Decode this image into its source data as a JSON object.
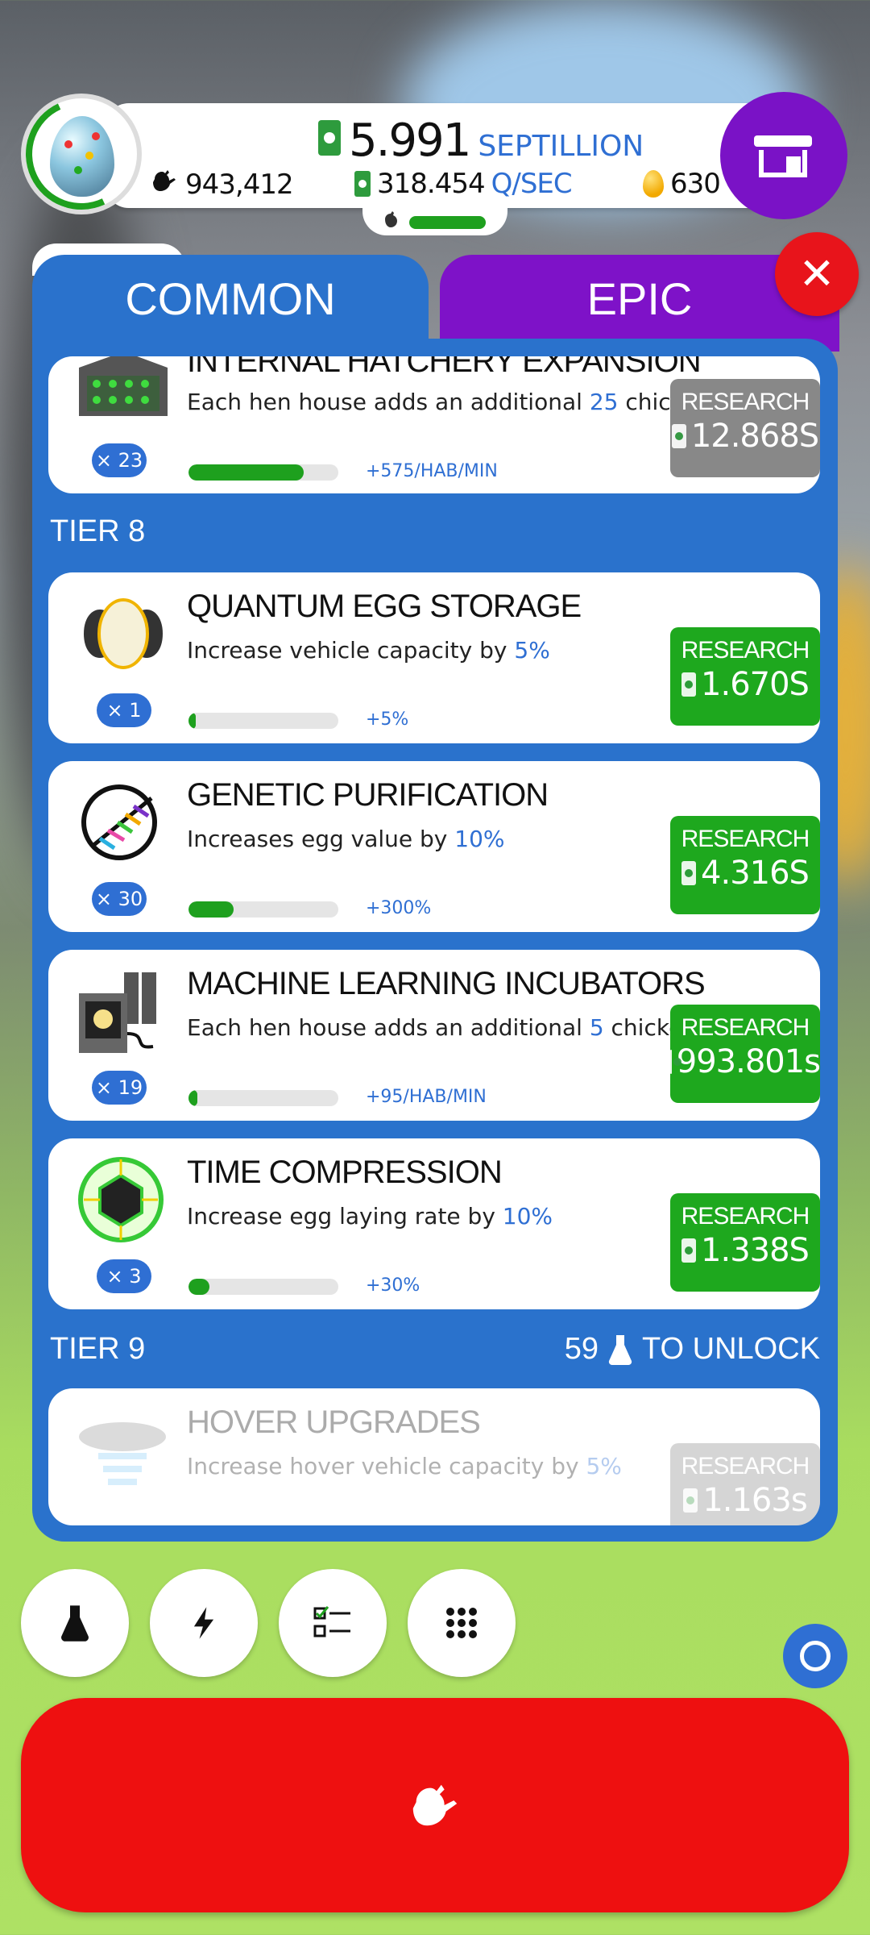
{
  "header": {
    "money_value": "5.991",
    "money_unit": "SEPTILLION",
    "chickens": "943,412",
    "income_value": "318.454",
    "income_unit": "Q/SEC",
    "golden_eggs": "630"
  },
  "tabs": {
    "common": "COMMON",
    "epic": "EPIC"
  },
  "research_items": [
    {
      "title": "INTERNAL HATCHERY EXPANSION",
      "desc_pre": "Each hen house adds an additional ",
      "desc_hl": "25",
      "desc_post": " chickens/min",
      "count": "× 23",
      "bonus": "+575/HAB/MIN",
      "button_label": "RESEARCH",
      "cost": "12.868S",
      "progress": 0.77
    },
    {
      "title": "QUANTUM EGG STORAGE",
      "desc_pre": "Increase vehicle capacity by ",
      "desc_hl": "5%",
      "desc_post": "",
      "count": "× 1",
      "bonus": "+5%",
      "button_label": "RESEARCH",
      "cost": "1.670S",
      "progress": 0.04
    },
    {
      "title": "GENETIC PURIFICATION",
      "desc_pre": "Increases egg value by ",
      "desc_hl": "10%",
      "desc_post": "",
      "count": "× 30",
      "bonus": "+300%",
      "button_label": "RESEARCH",
      "cost": "4.316S",
      "progress": 0.3
    },
    {
      "title": "MACHINE LEARNING INCUBATORS",
      "desc_pre": "Each hen house adds an additional ",
      "desc_hl": "5",
      "desc_post": " chickens/min",
      "count": "× 19",
      "bonus": "+95/HAB/MIN",
      "button_label": "RESEARCH",
      "cost": "993.801s",
      "progress": 0.06
    },
    {
      "title": "TIME COMPRESSION",
      "desc_pre": "Increase egg laying rate by ",
      "desc_hl": "10%",
      "desc_post": "",
      "count": "× 3",
      "bonus": "+30%",
      "button_label": "RESEARCH",
      "cost": "1.338S",
      "progress": 0.14
    },
    {
      "title": "HOVER UPGRADES",
      "desc_pre": "Increase hover vehicle capacity by ",
      "desc_hl": "5%",
      "desc_post": "",
      "button_label": "RESEARCH",
      "cost": "1.163s"
    }
  ],
  "tiers": {
    "tier8": "TIER 8",
    "tier9": "TIER 9",
    "unlock_count": "59",
    "unlock_text": "TO UNLOCK"
  },
  "icons": [
    "chicken-icon",
    "money-icon",
    "golden-egg-icon",
    "shop-icon",
    "close-icon",
    "flask-icon",
    "lightning-icon",
    "checklist-icon",
    "grid-icon",
    "chicken-hatch-icon"
  ],
  "colors": {
    "accent_blue": "#2a72cc",
    "epic_purple": "#7e12c8",
    "research_green": "#1ea81e",
    "hatch_red": "#ee1010"
  }
}
